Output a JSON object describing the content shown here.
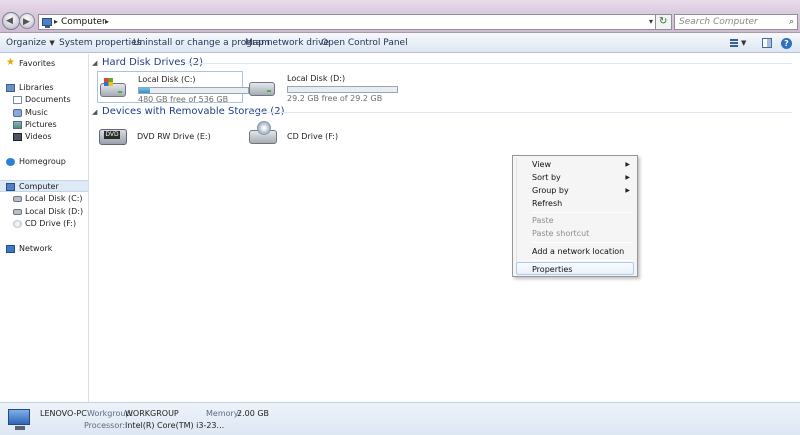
{
  "address": {
    "crumbs": [
      "Computer"
    ]
  },
  "search": {
    "placeholder": "Search Computer"
  },
  "commandbar": {
    "organize": "Organize",
    "system_properties": "System properties",
    "uninstall": "Uninstall or change a program",
    "map_drive": "Map network drive",
    "control_panel": "Open Control Panel"
  },
  "navpane": {
    "favorites": "Favorites",
    "libraries": "Libraries",
    "documents": "Documents",
    "music": "Music",
    "pictures": "Pictures",
    "videos": "Videos",
    "homegroup": "Homegroup",
    "computer": "Computer",
    "local_c": "Local Disk (C:)",
    "local_d": "Local Disk (D:)",
    "cd_drive": "CD Drive (F:)",
    "network": "Network"
  },
  "groups": {
    "hdd_title": "Hard Disk Drives (2)",
    "removable_title": "Devices with Removable Storage (2)"
  },
  "drives": [
    {
      "name": "Local Disk (C:)",
      "free_text": "480 GB free of 536 GB",
      "used_fraction": 0.105
    },
    {
      "name": "Local Disk (D:)",
      "free_text": "29.2 GB free of 29.2 GB",
      "used_fraction": 0.0
    }
  ],
  "removable": [
    {
      "name": "DVD RW Drive (E:)",
      "badge": "DVD"
    },
    {
      "name": "CD Drive (F:)"
    }
  ],
  "context_menu": {
    "view": "View",
    "sort_by": "Sort by",
    "group_by": "Group by",
    "refresh": "Refresh",
    "paste": "Paste",
    "paste_shortcut": "Paste shortcut",
    "add_network_location": "Add a network location",
    "properties": "Properties"
  },
  "details": {
    "pc_name": "LENOVO-PC",
    "workgroup_label": "Workgroup:",
    "workgroup_value": "WORKGROUP",
    "memory_label": "Memory:",
    "memory_value": "2.00 GB",
    "processor_label": "Processor:",
    "processor_value": "Intel(R) Core(TM) i3-23..."
  },
  "colors": {
    "accent": "#1e3f87",
    "selection": "#dfe9f6",
    "menu_highlight": "#e8f0fa",
    "usage_fill": "#2b93c9"
  },
  "icons": {
    "nav_back": "back-arrow-icon",
    "nav_forward": "forward-arrow-icon",
    "refresh": "refresh-icon",
    "search": "search-icon",
    "help": "help-icon"
  }
}
